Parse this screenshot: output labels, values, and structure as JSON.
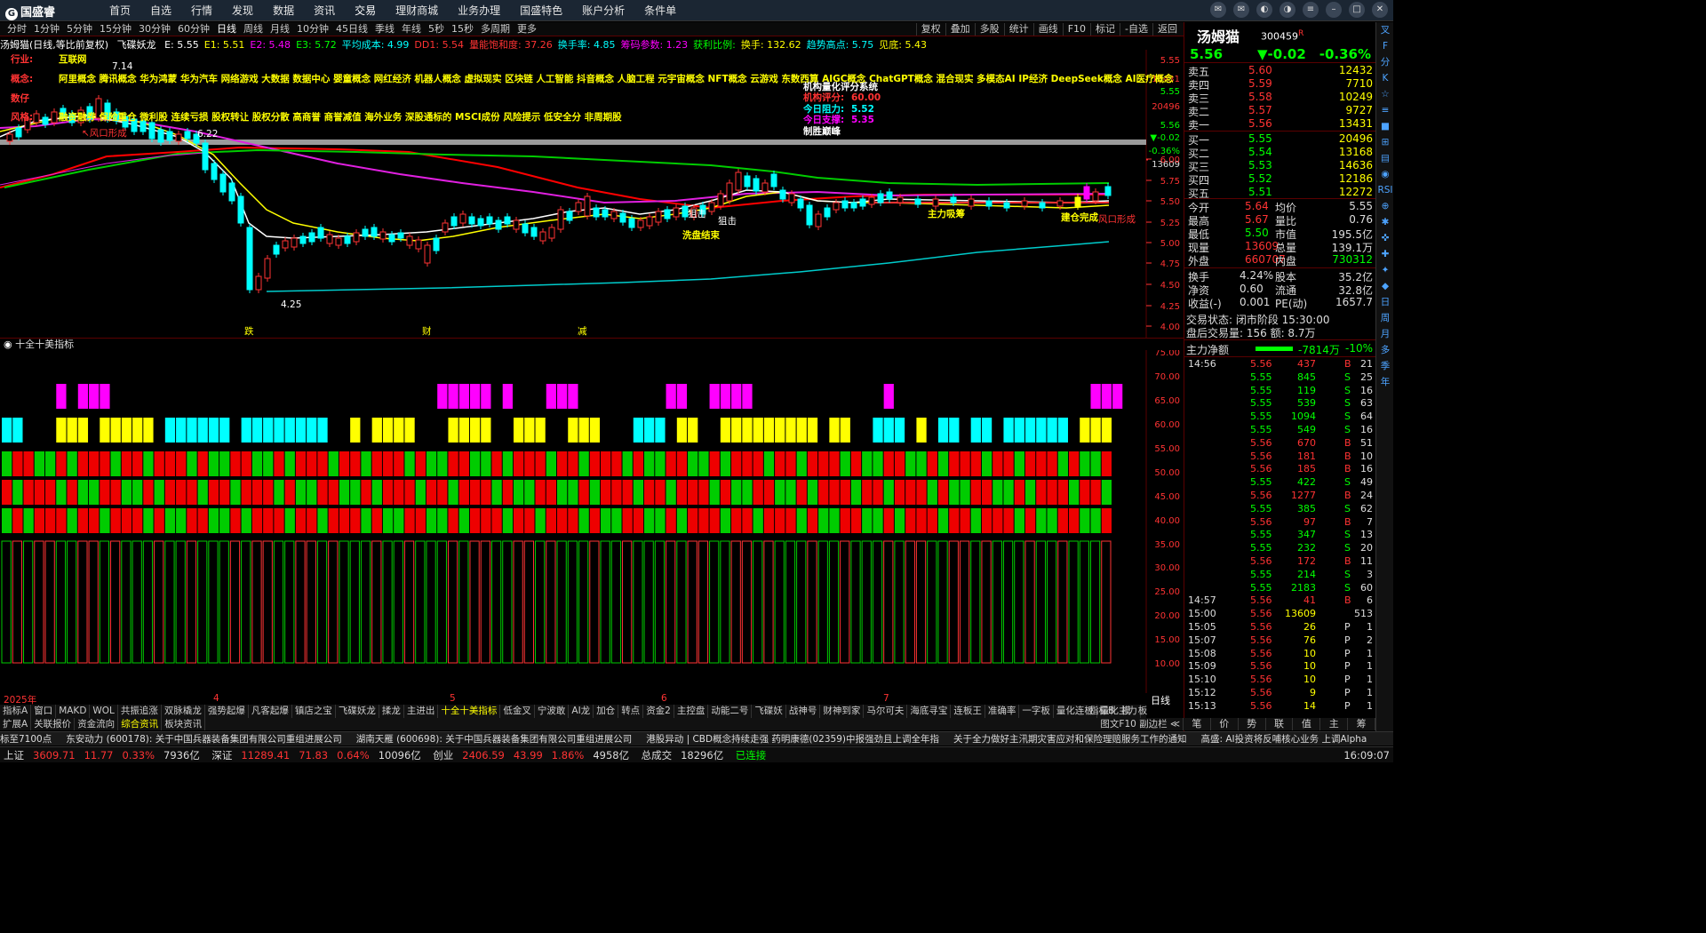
{
  "app": {
    "logo": "国盛睿",
    "menu": [
      "首页",
      "自选",
      "行情",
      "发现",
      "数据",
      "资讯",
      "交易",
      "理财商城",
      "业务办理",
      "国盛特色",
      "账户分析",
      "条件单"
    ],
    "active_menu": "交易"
  },
  "period_bar": {
    "periods": [
      "分时",
      "1分钟",
      "5分钟",
      "15分钟",
      "30分钟",
      "60分钟",
      "日线",
      "周线",
      "月线",
      "10分钟",
      "45日线",
      "季线",
      "年线",
      "5秒",
      "15秒",
      "多周期",
      "更多"
    ],
    "active": "日线",
    "tools": [
      "复权",
      "叠加",
      "多股",
      "统计",
      "画线",
      "F10",
      "标记",
      "-自选",
      "返回"
    ]
  },
  "indicator_line": {
    "name": "汤姆猫(日线,等比前复权)",
    "formula": "飞碟妖龙",
    "items": [
      {
        "t": "E: 5.55",
        "c": "#fff"
      },
      {
        "t": "E1: 5.51",
        "c": "#ff0"
      },
      {
        "t": "E2: 5.48",
        "c": "#f0f"
      },
      {
        "t": "E3: 5.72",
        "c": "#0f0"
      },
      {
        "t": "平均成本: 4.99",
        "c": "#0ff"
      },
      {
        "t": "DD1: 5.54",
        "c": "#f33"
      },
      {
        "t": "量能饱和度: 37.26",
        "c": "#f33"
      },
      {
        "t": "换手率: 4.85",
        "c": "#0ff"
      },
      {
        "t": "筹码参数: 1.23",
        "c": "#f0f"
      },
      {
        "t": "获利比例:",
        "c": "#0f0"
      },
      {
        "t": "换手: 132.62",
        "c": "#ff0"
      },
      {
        "t": "趋势高点: 5.75",
        "c": "#0ff"
      },
      {
        "t": "见底: 5.43",
        "c": "#ff0"
      }
    ]
  },
  "info_block": {
    "industry_label": "行业:",
    "industry": "互联网",
    "concept_label": "概念:",
    "concepts": "阿里概念 腾讯概念 华为鸿蒙 华为汽车 网络游戏 大数据 数据中心 婴童概念 网红经济 机器人概念 虚拟现实 区块链 人工智能 抖音概念 人脑工程 元宇宙概念 NFT概念 云游戏 东数西算 AIGC概念 ChatGPT概念 混合现实 多模态AI IP经济 DeepSeek概念 AI医疗概念",
    "extra_label": "数仔",
    "style_label": "风格:",
    "styles": "融资融券 保险重仓 微利股 连续亏损 股权转让 股权分散 高商誉 商誉减值 海外业务 深股通标的 MSCI成份 风险提示 低安全分 非周期股",
    "inst_title": "机构量化评分系统",
    "inst_score_label": "机构评分:",
    "inst_score": "60.00",
    "resist_label": "今日阻力:",
    "resist": "5.52",
    "support_label": "今日支撑:",
    "support": "5.35",
    "verdict": "制胜巅峰"
  },
  "chart_annotations": {
    "high": "7.14",
    "low": "4.25",
    "level": "6.22",
    "wind_exit": "↖风口形成",
    "wash_end": "洗盘结束",
    "hit1": "狙击",
    "hit2": "狙击",
    "main_absorb": "主力吸筹",
    "build_done": "建仓完成",
    "wind_form": "风口形成",
    "ticks": [
      "跌",
      "财",
      "减"
    ]
  },
  "main_yaxis": [
    "5.55",
    "13431",
    "5.55",
    "20496",
    "5.56",
    "▼-0.02",
    "-0.36%",
    "13609",
    "6.00",
    "5.75",
    "5.50",
    "5.25",
    "5.00",
    "4.75",
    "4.50",
    "4.25",
    "4.00"
  ],
  "sub_header": "十全十美指标",
  "sub_yaxis": [
    "75.00",
    "70.00",
    "65.00",
    "60.00",
    "55.00",
    "50.00",
    "45.00",
    "40.00",
    "35.00",
    "30.00",
    "25.00",
    "20.00",
    "15.00",
    "10.00"
  ],
  "x_labels": [
    "2025年",
    "4",
    "5",
    "6",
    "7"
  ],
  "x_right_label": "日线",
  "tabs1": [
    "指标A",
    "窗口",
    "MAKD",
    "WOL",
    "共振追涨",
    "双脉橇龙",
    "强势起爆",
    "凡客起爆",
    "镇店之宝",
    "飞碟妖龙",
    "揉龙",
    "主进出",
    "十全十美指标",
    "低金叉",
    "宁波敢",
    "AI龙",
    "加仓",
    "转点",
    "资金2",
    "主控盘",
    "动能二号",
    "飞碟妖",
    "战神号",
    "财神到家",
    "马尔可夫",
    "海底寻宝",
    "连板王",
    "准确率",
    "一字板",
    "量化连板",
    "量化主力"
  ],
  "tabs1_active": "十全十美指标",
  "tabs1_right": [
    "指标B",
    "模",
    "板"
  ],
  "tabs2": [
    "扩展A",
    "关联报价",
    "资金流向",
    "综合资讯",
    "板块资讯"
  ],
  "tabs2_active": "综合资讯",
  "tabs2_right": "图文F10 副边栏 ≪",
  "quote": {
    "name": "汤姆猫",
    "code": "300459",
    "flag": "R",
    "price": "5.56",
    "change": "▼-0.02",
    "pct": "-0.36%",
    "asks": [
      [
        "卖五",
        "5.60",
        "12432"
      ],
      [
        "卖四",
        "5.59",
        "7710"
      ],
      [
        "卖三",
        "5.58",
        "10249"
      ],
      [
        "卖二",
        "5.57",
        "9727"
      ],
      [
        "卖一",
        "5.56",
        "13431"
      ]
    ],
    "bids": [
      [
        "买一",
        "5.55",
        "20496"
      ],
      [
        "买二",
        "5.54",
        "13168"
      ],
      [
        "买三",
        "5.53",
        "14636"
      ],
      [
        "买四",
        "5.52",
        "12186"
      ],
      [
        "买五",
        "5.51",
        "12272"
      ]
    ],
    "stats": [
      [
        "今开",
        "5.64",
        "均价",
        "5.55"
      ],
      [
        "最高",
        "5.67",
        "量比",
        "0.76"
      ],
      [
        "最低",
        "5.50",
        "市值",
        "195.5亿"
      ],
      [
        "现量",
        "13609",
        "总量",
        "139.1万"
      ],
      [
        "外盘",
        "660707",
        "内盘",
        "730312"
      ]
    ],
    "stats2": [
      [
        "换手",
        "4.24%",
        "股本",
        "35.2亿"
      ],
      [
        "净资",
        "0.60",
        "流通",
        "32.8亿"
      ],
      [
        "收益(-)",
        "0.001",
        "PE(动)",
        "1657.7"
      ]
    ],
    "trade_state": "交易状态: 闭市阶段 15:30:00",
    "after_hours": "盘后交易量: 156  额: 8.7万",
    "main_flow_label": "主力净额",
    "main_flow": "-7814万",
    "main_flow_pct": "-10%"
  },
  "trades": [
    [
      "14:56",
      "5.56",
      "437",
      "B",
      "21"
    ],
    [
      "",
      "5.55",
      "845",
      "S",
      "25"
    ],
    [
      "",
      "5.55",
      "119",
      "S",
      "16"
    ],
    [
      "",
      "5.55",
      "539",
      "S",
      "63"
    ],
    [
      "",
      "5.55",
      "1094",
      "S",
      "64"
    ],
    [
      "",
      "5.55",
      "549",
      "S",
      "16"
    ],
    [
      "",
      "5.56",
      "670",
      "B",
      "51"
    ],
    [
      "",
      "5.56",
      "181",
      "B",
      "10"
    ],
    [
      "",
      "5.56",
      "185",
      "B",
      "16"
    ],
    [
      "",
      "5.55",
      "422",
      "S",
      "49"
    ],
    [
      "",
      "5.56",
      "1277",
      "B",
      "24"
    ],
    [
      "",
      "5.55",
      "385",
      "S",
      "62"
    ],
    [
      "",
      "5.56",
      "97",
      "B",
      "7"
    ],
    [
      "",
      "5.55",
      "347",
      "S",
      "13"
    ],
    [
      "",
      "5.55",
      "232",
      "S",
      "20"
    ],
    [
      "",
      "5.56",
      "172",
      "B",
      "11"
    ],
    [
      "",
      "5.55",
      "214",
      "S",
      "3"
    ],
    [
      "",
      "5.55",
      "2183",
      "S",
      "60"
    ],
    [
      "14:57",
      "5.56",
      "41",
      "B",
      "6"
    ],
    [
      "15:00",
      "5.56",
      "13609",
      "",
      "513"
    ],
    [
      "15:05",
      "5.56",
      "26",
      "P",
      "1"
    ],
    [
      "15:07",
      "5.56",
      "76",
      "P",
      "2"
    ],
    [
      "15:08",
      "5.56",
      "10",
      "P",
      "1"
    ],
    [
      "15:09",
      "5.56",
      "10",
      "P",
      "1"
    ],
    [
      "15:10",
      "5.56",
      "10",
      "P",
      "1"
    ],
    [
      "15:12",
      "5.56",
      "9",
      "P",
      "1"
    ],
    [
      "15:13",
      "5.56",
      "14",
      "P",
      "1"
    ]
  ],
  "bottom_tabs": [
    "笔",
    "价",
    "势",
    "联",
    "值",
    "主",
    "筹"
  ],
  "right_sidebar": [
    "叉",
    "F",
    "分",
    "K",
    "☆",
    "≡",
    "■",
    "⊞",
    "▤",
    "◉",
    "RSI",
    "⊕",
    "✱",
    "✜",
    "✚",
    "✦",
    "◆",
    "日",
    "周",
    "月",
    "多",
    "季",
    "年"
  ],
  "news": [
    "标至7100点",
    "东安动力 (600178): 关于中国兵器装备集团有限公司重组进展公司",
    "湖南天雁 (600698): 关于中国兵器装备集团有限公司重组进展公司",
    "港股异动 | CBD概念持续走强 药明康德(02359)中报强劲且上调全年指",
    "关于全力做好主汛期灾害应对和保险理赔服务工作的通知",
    "高盛: AI投资将反哺核心业务 上调Alpha"
  ],
  "status": {
    "sh_label": "上证",
    "sh": "3609.71",
    "sh_chg": "11.77",
    "sh_pct": "0.33%",
    "sh_amt": "7936亿",
    "sz_label": "深证",
    "sz": "11289.41",
    "sz_chg": "71.83",
    "sz_pct": "0.64%",
    "sz_amt": "10096亿",
    "cy_label": "创业",
    "cy": "2406.59",
    "cy_chg": "43.99",
    "cy_pct": "1.86%",
    "cy_amt": "4958亿",
    "total_label": "总成交",
    "total": "18296亿",
    "conn": "已连接",
    "time": "16:09:07"
  },
  "colors": {
    "up": "#ff2020",
    "down": "#00e0e0",
    "bg": "#000000",
    "grid": "#5a0000"
  }
}
